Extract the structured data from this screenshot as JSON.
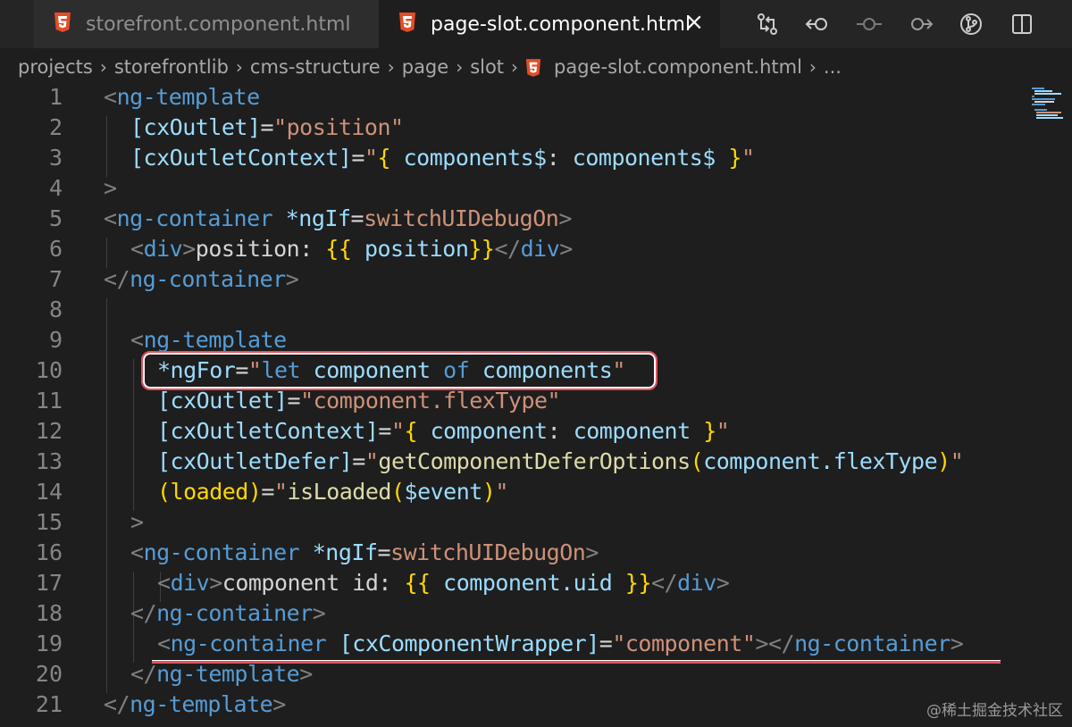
{
  "tabs": [
    {
      "label": "storefront.component.html",
      "icon": "html5-icon",
      "active": false
    },
    {
      "label": "page-slot.component.html",
      "icon": "html5-icon",
      "active": true,
      "close": "×"
    }
  ],
  "toolbar_actions": [
    "source-control-compare-icon",
    "go-back-icon",
    "timeline-icon",
    "go-forward-icon",
    "git-graph-icon",
    "split-editor-icon"
  ],
  "breadcrumb": [
    "projects",
    "storefrontlib",
    "cms-structure",
    "page",
    "slot",
    "page-slot.component.html",
    "..."
  ],
  "line_numbers": [
    "1",
    "2",
    "3",
    "4",
    "5",
    "6",
    "7",
    "8",
    "9",
    "10",
    "11",
    "12",
    "13",
    "14",
    "15",
    "16",
    "17",
    "18",
    "19",
    "20",
    "21"
  ],
  "code": {
    "l1": {
      "open": "<",
      "tag": "ng-template"
    },
    "l2": {
      "attr": "[cxOutlet]",
      "eq": "=",
      "val": "\"position\""
    },
    "l3": {
      "attr": "[cxOutletContext]",
      "eq": "=",
      "q1": "\"",
      "b1": "{",
      "v1": " components$",
      "c": ": ",
      "v2": "components$",
      "b2": " }",
      "q2": "\""
    },
    "l4": {
      "close": ">"
    },
    "l5": {
      "open": "<",
      "tag": "ng-container",
      "attr": " *ngIf",
      "eq": "=",
      "val": "switchUIDebugOn",
      "close": ">"
    },
    "l6": {
      "open": "<",
      "tag": "div",
      "close": ">",
      "text": "position: ",
      "b1": "{{",
      "v": " position",
      "b2": "}}",
      "open2": "</",
      "tag2": "div",
      "close2": ">"
    },
    "l7": {
      "open": "</",
      "tag": "ng-container",
      "close": ">"
    },
    "l9": {
      "open": "<",
      "tag": "ng-template"
    },
    "l10": {
      "attr": "*ngFor",
      "eq": "=",
      "q1": "\"",
      "kw1": "let",
      "v1": " component ",
      "kw2": "of",
      "v2": " components",
      "q2": "\""
    },
    "l11": {
      "attr": "[cxOutlet]",
      "eq": "=",
      "val": "\"component.flexType\""
    },
    "l12": {
      "attr": "[cxOutletContext]",
      "eq": "=",
      "q1": "\"",
      "b1": "{",
      "v1": " component",
      "c": ": ",
      "v2": "component",
      "b2": " }",
      "q2": "\""
    },
    "l13": {
      "attr": "[cxOutletDefer]",
      "eq": "=",
      "q1": "\"",
      "fn": "getComponentDeferOptions",
      "p1": "(",
      "v": "component.flexType",
      "p2": ")",
      "q2": "\""
    },
    "l14": {
      "attr": "(loaded)",
      "eq": "=",
      "q1": "\"",
      "fn": "isLoaded",
      "p1": "(",
      "v": "$event",
      "p2": ")",
      "q2": "\""
    },
    "l15": {
      "close": ">"
    },
    "l16": {
      "open": "<",
      "tag": "ng-container",
      "attr": " *ngIf",
      "eq": "=",
      "val": "switchUIDebugOn",
      "close": ">"
    },
    "l17": {
      "open": "<",
      "tag": "div",
      "close": ">",
      "text": "component id: ",
      "b1": "{{",
      "v": " component.uid ",
      "b2": "}}",
      "open2": "</",
      "tag2": "div",
      "close2": ">"
    },
    "l18": {
      "open": "</",
      "tag": "ng-container",
      "close": ">"
    },
    "l19": {
      "open": "<",
      "tag": "ng-container",
      "attr": " [cxComponentWrapper]",
      "eq": "=",
      "val": "\"component\"",
      "close": ">",
      "open2": "</",
      "tag2": "ng-container",
      "close2": ">"
    },
    "l20": {
      "open": "</",
      "tag": "ng-template",
      "close": ">"
    },
    "l21": {
      "open": "</",
      "tag": "ng-template",
      "close": ">"
    }
  },
  "watermark": "@稀土掘金技术社区",
  "colors": {
    "highlight": "#e0535f",
    "tag": "#569cd6",
    "string": "#ce9178",
    "attribute": "#9cdcfe"
  }
}
